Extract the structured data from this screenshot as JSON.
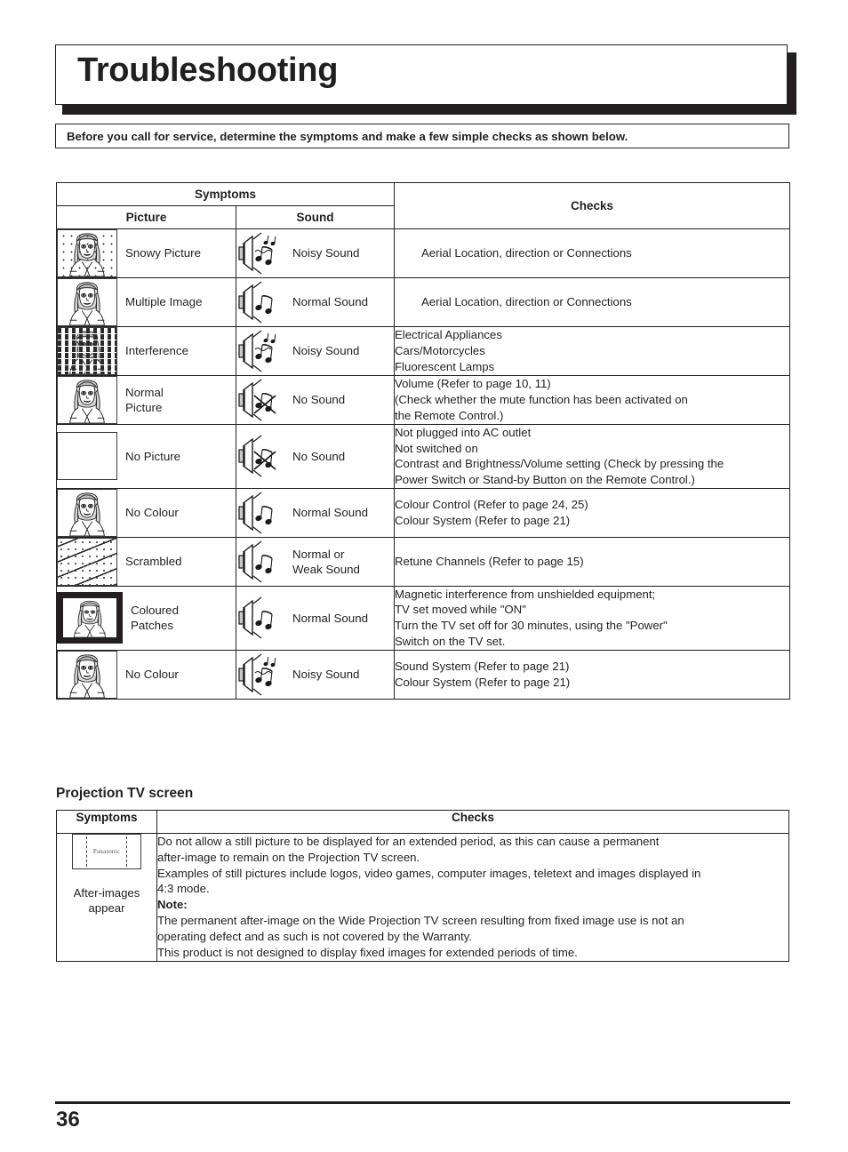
{
  "page": {
    "title": "Troubleshooting",
    "intro_banner": "Before you call for service, determine the symptoms and make a few simple checks as shown below.",
    "page_number": "36",
    "accent_color": "#231f20"
  },
  "main_table": {
    "header_symptoms": "Symptoms",
    "header_picture": "Picture",
    "header_sound": "Sound",
    "header_checks": "Checks",
    "rows": [
      {
        "picture_label": "Snowy Picture",
        "picture_icon": "tv-snowy-icon",
        "sound_label": "Noisy Sound",
        "sound_icon": "speaker-noisy-icon",
        "checks": [
          "Aerial Location, direction or Connections"
        ],
        "checks_indent": true
      },
      {
        "picture_label": "Multiple Image",
        "picture_icon": "tv-multiple-image-icon",
        "sound_label": "Normal Sound",
        "sound_icon": "speaker-normal-icon",
        "checks": [
          "Aerial Location, direction or Connections"
        ],
        "checks_indent": true
      },
      {
        "picture_label": "Interference",
        "picture_icon": "tv-interference-icon",
        "sound_label": "Noisy Sound",
        "sound_icon": "speaker-noisy-icon",
        "checks": [
          "Electrical Appliances",
          "Cars/Motorcycles",
          "Fluorescent Lamps"
        ],
        "checks_indent": false
      },
      {
        "picture_label": "Normal\nPicture",
        "picture_icon": "tv-normal-picture-icon",
        "sound_label": "No Sound",
        "sound_icon": "speaker-muted-icon",
        "checks": [
          "Volume (Refer to page 10, 11)",
          "(Check whether the mute function has been activated on",
          "the Remote Control.)"
        ],
        "checks_indent": false,
        "justify_lines": [
          1
        ]
      },
      {
        "picture_label": "No Picture",
        "picture_icon": "tv-blank-icon",
        "sound_label": "No Sound",
        "sound_icon": "speaker-muted-icon",
        "checks": [
          "Not plugged into AC outlet",
          "Not switched on",
          "Contrast and Brightness/Volume setting (Check by pressing the",
          "Power Switch or Stand-by Button on the Remote Control.)"
        ],
        "checks_indent": false
      },
      {
        "picture_label": "No Colour",
        "picture_icon": "tv-normal-picture-icon",
        "sound_label": "Normal Sound",
        "sound_icon": "speaker-normal-icon",
        "checks": [
          "Colour Control (Refer to page 24, 25)",
          "Colour System (Refer to page 21)"
        ],
        "checks_indent": false
      },
      {
        "picture_label": "Scrambled",
        "picture_icon": "tv-scrambled-icon",
        "sound_label": "Normal or\nWeak Sound",
        "sound_icon": "speaker-normal-icon",
        "checks": [
          "Retune Channels (Refer to page 15)"
        ],
        "checks_indent": false
      },
      {
        "picture_label": "Coloured\nPatches",
        "picture_icon": "tv-coloured-patches-icon",
        "sound_label": "Normal Sound",
        "sound_icon": "speaker-normal-icon",
        "checks": [
          "Magnetic interference from unshielded equipment;",
          "TV set moved while  \"ON\"",
          "Turn the TV set off for 30 minutes, using the \"Power\"",
          "Switch on the TV set."
        ],
        "checks_indent": false,
        "justify_lines": [
          2
        ]
      },
      {
        "picture_label": "No Colour",
        "picture_icon": "tv-normal-picture-icon",
        "sound_label": "Noisy Sound",
        "sound_icon": "speaker-noisy-icon",
        "checks": [
          "Sound System (Refer to page 21)",
          "Colour System (Refer to page 21)"
        ],
        "checks_indent": false
      }
    ]
  },
  "projection_section": {
    "heading": "Projection TV screen",
    "header_symptoms": "Symptoms",
    "header_checks": "Checks",
    "symptom_label_line1": "After-images",
    "symptom_label_line2": "appear",
    "symptom_icon": "tv-after-image-icon",
    "screen_brand_text": "Panasonic",
    "body_lines": [
      "Do not allow a still picture to be displayed for an extended period, as this can cause a permanent",
      "after-image to remain on the Projection TV screen.",
      "Examples of still pictures include logos, video games, computer images, teletext and images displayed in",
      "4:3 mode."
    ],
    "note_label": "Note:",
    "note_lines": [
      "The permanent after-image on the Wide Projection TV screen resulting from fixed image use is not an",
      "operating defect and as such is not covered by the Warranty.",
      "This product is not designed to display fixed images for extended periods of time."
    ]
  }
}
